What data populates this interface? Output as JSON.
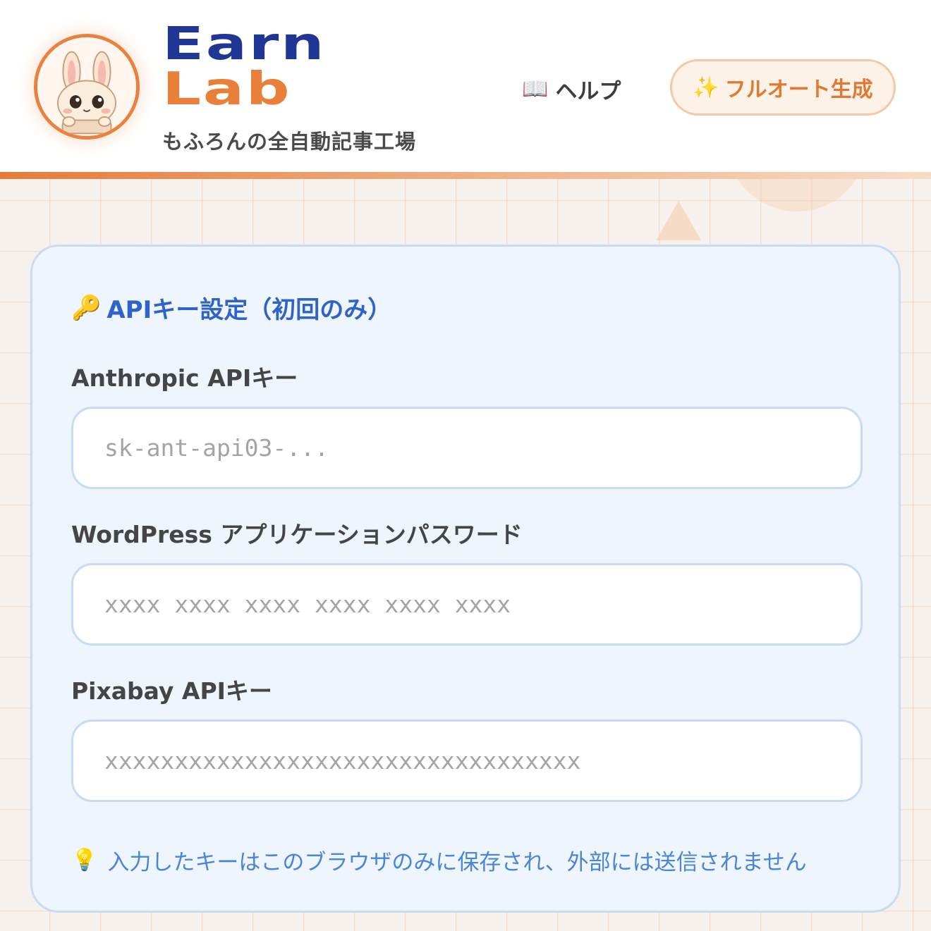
{
  "header": {
    "logo_line1": "Earn",
    "logo_line2": "Lab",
    "tagline": "もふろんの全自動記事工場",
    "help_icon": "📖",
    "help_label": "ヘルプ",
    "auto_icon": "✨",
    "auto_label": "フルオート生成"
  },
  "card": {
    "title_icon": "🔑",
    "title": "APIキー設定（初回のみ）",
    "fields": [
      {
        "label": "Anthropic APIキー",
        "value": "",
        "placeholder": "sk-ant-api03-..."
      },
      {
        "label": "WordPress アプリケーションパスワード",
        "value": "",
        "placeholder": "xxxx xxxx xxxx xxxx xxxx xxxx"
      },
      {
        "label": "Pixabay APIキー",
        "value": "",
        "placeholder": "xxxxxxxxxxxxxxxxxxxxxxxxxxxxxxxxxx"
      }
    ],
    "note_icon": "💡",
    "note": "入力したキーはこのブラウザのみに保存され、外部には送信されません"
  },
  "colors": {
    "brand_blue": "#1f3694",
    "brand_orange": "#e8803a",
    "card_bg": "#eef5fd",
    "title_blue": "#2f63c9",
    "note_blue": "#4a85d6"
  },
  "icons": [
    "bunny-mascot",
    "book-icon",
    "sparkles-icon",
    "key-icon",
    "lightbulb-icon"
  ]
}
